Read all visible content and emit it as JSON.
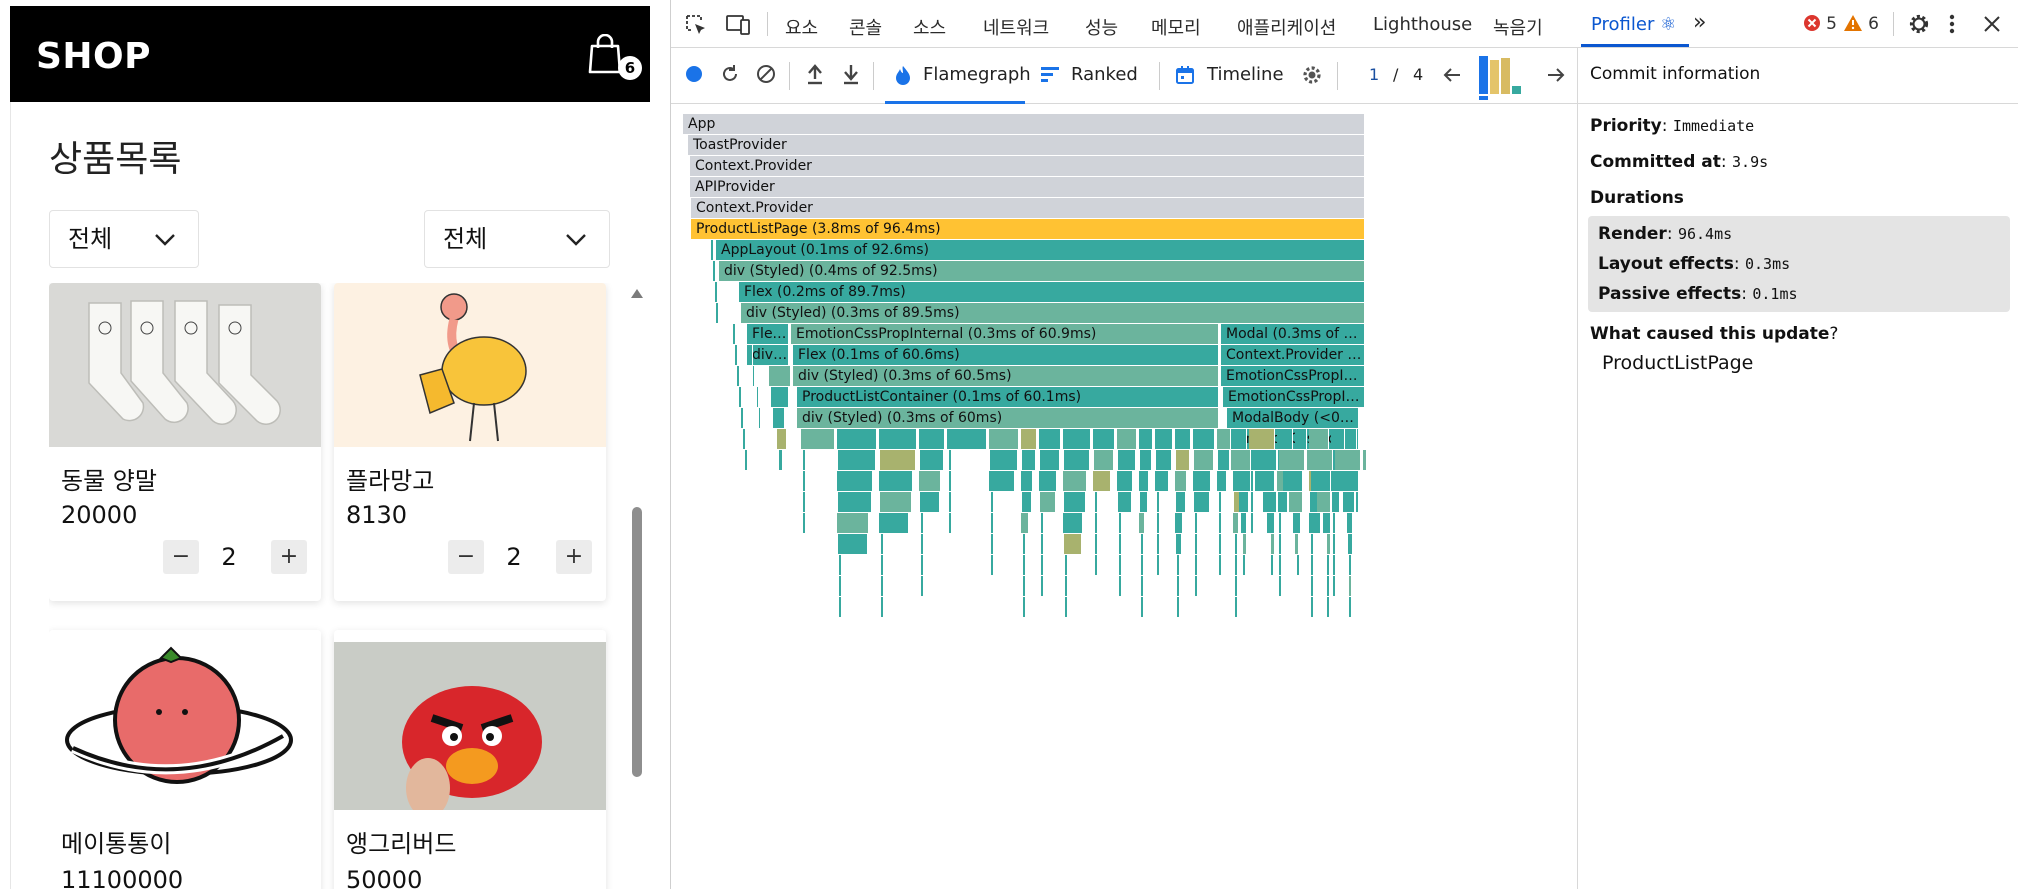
{
  "shop": {
    "logo": "SHOP",
    "cart_count": "6",
    "page_title": "상품목록",
    "filter_category": "전체",
    "filter_sort": "전체",
    "products": [
      {
        "name": "동물 양말",
        "price": "20000",
        "quantity": "2"
      },
      {
        "name": "플라망고",
        "price": "8130",
        "quantity": "2"
      },
      {
        "name": "메이통통이",
        "price": "11100000"
      },
      {
        "name": "앵그리버드",
        "price": "50000"
      }
    ],
    "minus_label": "−",
    "plus_label": "+"
  },
  "devtools": {
    "tabs": [
      "요소",
      "콘솔",
      "소스",
      "네트워크",
      "성능",
      "메모리",
      "애플리케이션",
      "Lighthouse",
      "녹음기"
    ],
    "active_tab": "Profiler ⚛",
    "more_tabs": "»",
    "error_count": "5",
    "warning_count": "6"
  },
  "profiler": {
    "views": {
      "flamegraph": "Flamegraph",
      "ranked": "Ranked",
      "timeline": "Timeline"
    },
    "commit_current": "1",
    "commit_sep": "/",
    "commit_total": "4",
    "commit_bars": [
      0.95,
      0.85,
      0.9,
      0.2
    ],
    "flame_colors": {
      "gray": "#d0d3d9",
      "selected": "#ffc233",
      "teal": "#37a99f",
      "teal_light": "#6bb49d",
      "olive": "#a8b26e"
    },
    "flame_bars": [
      {
        "label": "App"
      },
      {
        "label": "ToastProvider"
      },
      {
        "label": "Context.Provider"
      },
      {
        "label": "APIProvider"
      },
      {
        "label": "Context.Provider"
      },
      {
        "label": "ProductListPage (3.8ms of 96.4ms)"
      },
      {
        "label": "AppLayout (0.1ms of 92.6ms)"
      },
      {
        "label": "div (Styled) (0.4ms of 92.5ms)"
      },
      {
        "label": "Flex (0.2ms of 89.7ms)"
      },
      {
        "label": "div (Styled) (0.3ms of 89.5ms)"
      },
      {
        "label": "Flex…"
      },
      {
        "label": "EmotionCssPropInternal (0.3ms of 60.9ms)"
      },
      {
        "label": "Modal (0.3ms of 21.…"
      },
      {
        "label": "div …"
      },
      {
        "label": "Flex (0.1ms of 60.6ms)"
      },
      {
        "label": "Context.Provider (<…"
      },
      {
        "label": "div (Styled) (0.3ms of 60.5ms)"
      },
      {
        "label": "EmotionCssPropInte…"
      },
      {
        "label": "ProductListContainer (0.1ms of 60.1ms)"
      },
      {
        "label": "EmotionCssPropInt…"
      },
      {
        "label": "div (Styled) (0.3ms of 60ms)"
      },
      {
        "label": "ModalBody (<0.1…"
      },
      {
        "label": "EmotionCssPropI…"
      }
    ]
  },
  "commit": {
    "header": "Commit information",
    "priority_label": "Priority",
    "priority_value": "Immediate",
    "committed_label": "Committed at",
    "committed_value": "3.9s",
    "durations_label": "Durations",
    "render_label": "Render",
    "render_value": "96.4ms",
    "layout_label": "Layout effects",
    "layout_value": "0.3ms",
    "passive_label": "Passive effects",
    "passive_value": "0.1ms",
    "cause_label": "What caused this update",
    "cause_qmark": "?",
    "cause_value": "ProductListPage"
  }
}
